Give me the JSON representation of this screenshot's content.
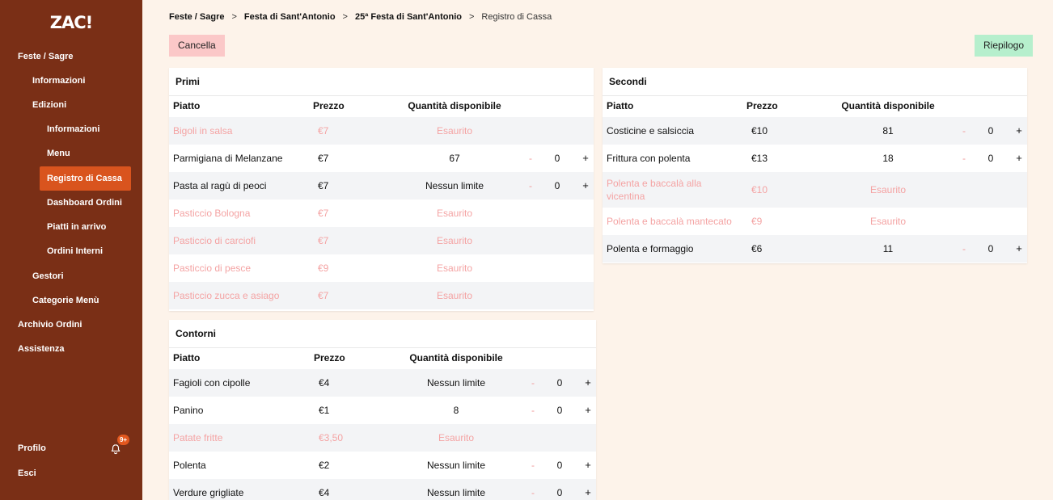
{
  "app": {
    "logo": "ZAC!"
  },
  "sidebar": {
    "items": [
      {
        "label": "Feste / Sagre"
      },
      {
        "label": "Informazioni"
      },
      {
        "label": "Edizioni"
      },
      {
        "label": "Informazioni"
      },
      {
        "label": "Menu"
      },
      {
        "label": "Registro di Cassa",
        "active": true
      },
      {
        "label": "Dashboard Ordini"
      },
      {
        "label": "Piatti in arrivo"
      },
      {
        "label": "Ordini Interni"
      },
      {
        "label": "Gestori"
      },
      {
        "label": "Categorie Menù"
      },
      {
        "label": "Archivio Ordini"
      },
      {
        "label": "Assistenza"
      }
    ],
    "profile_label": "Profilo",
    "logout_label": "Esci",
    "notification_badge": "9+"
  },
  "breadcrumb": {
    "items": [
      "Feste / Sagre",
      "Festa di Sant'Antonio",
      "25ª Festa di Sant'Antonio",
      "Registro di Cassa"
    ],
    "separator": ">"
  },
  "actions": {
    "cancel_label": "Cancella",
    "summary_label": "Riepilogo"
  },
  "colors": {
    "sidebar": "#7a2f16",
    "active": "#d9541e",
    "background": "#fdf3ea",
    "sold_out_text": "#f4a3a3",
    "cancel": "#fbc8c8",
    "summary": "#b6efcd"
  },
  "columns": {
    "dish": "Piatto",
    "price": "Prezzo",
    "available": "Quantità disponibile"
  },
  "sections": {
    "primi": {
      "title": "Primi",
      "rows": [
        {
          "name": "Bigoli in salsa",
          "price": "€7",
          "available": "Esaurito",
          "sold_out": true
        },
        {
          "name": "Parmigiana di Melanzane",
          "price": "€7",
          "available": "67",
          "minus": "-",
          "count": "0",
          "plus": "+"
        },
        {
          "name": "Pasta al ragù di peoci",
          "price": "€7",
          "available": "Nessun limite",
          "minus": "-",
          "count": "0",
          "plus": "+"
        },
        {
          "name": "Pasticcio Bologna",
          "price": "€7",
          "available": "Esaurito",
          "sold_out": true
        },
        {
          "name": "Pasticcio di carciofi",
          "price": "€7",
          "available": "Esaurito",
          "sold_out": true
        },
        {
          "name": "Pasticcio di pesce",
          "price": "€9",
          "available": "Esaurito",
          "sold_out": true
        },
        {
          "name": "Pasticcio zucca e asiago",
          "price": "€7",
          "available": "Esaurito",
          "sold_out": true
        }
      ]
    },
    "secondi": {
      "title": "Secondi",
      "rows": [
        {
          "name": "Costicine e salsiccia",
          "price": "€10",
          "available": "81",
          "minus": "-",
          "count": "0",
          "plus": "+"
        },
        {
          "name": "Frittura con polenta",
          "price": "€13",
          "available": "18",
          "minus": "-",
          "count": "0",
          "plus": "+"
        },
        {
          "name": "Polenta e baccalà alla vicentina",
          "price": "€10",
          "available": "Esaurito",
          "sold_out": true,
          "tall": true
        },
        {
          "name": "Polenta e baccalà mantecato",
          "price": "€9",
          "available": "Esaurito",
          "sold_out": true
        },
        {
          "name": "Polenta e formaggio",
          "price": "€6",
          "available": "11",
          "minus": "-",
          "count": "0",
          "plus": "+"
        }
      ]
    },
    "contorni": {
      "title": "Contorni",
      "rows": [
        {
          "name": "Fagioli con cipolle",
          "price": "€4",
          "available": "Nessun limite",
          "minus": "-",
          "count": "0",
          "plus": "+"
        },
        {
          "name": "Panino",
          "price": "€1",
          "available": "8",
          "minus": "-",
          "count": "0",
          "plus": "+"
        },
        {
          "name": "Patate fritte",
          "price": "€3,50",
          "available": "Esaurito",
          "sold_out": true
        },
        {
          "name": "Polenta",
          "price": "€2",
          "available": "Nessun limite",
          "minus": "-",
          "count": "0",
          "plus": "+"
        },
        {
          "name": "Verdure grigliate",
          "price": "€4",
          "available": "Nessun limite",
          "minus": "-",
          "count": "0",
          "plus": "+"
        }
      ]
    }
  }
}
